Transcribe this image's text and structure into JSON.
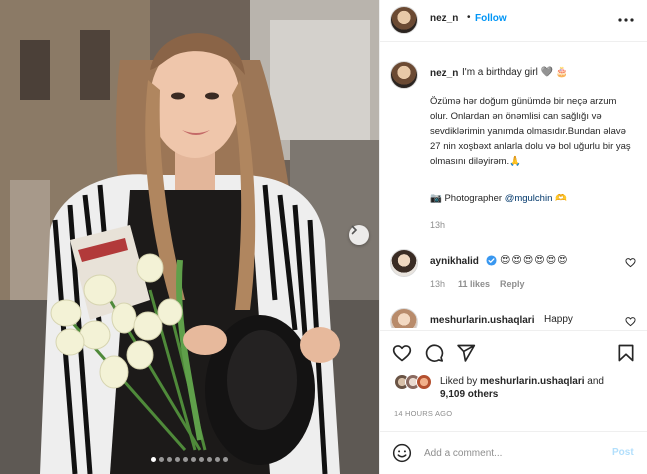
{
  "post": {
    "author": "nez_n",
    "separator": "•",
    "follow_label": "Follow",
    "more_icon": "more-options-icon",
    "image_count": 10,
    "active_image_index": 0
  },
  "caption": {
    "username": "nez_n",
    "first_line": "I'm a birthday girl 🩶 🎂",
    "body": "Özümə hər doğum günümdə bir neçə arzum olur. Onlardan ən önəmlisi can sağlığı və sevdiklərimin yanımda olmasıdır.Bundan əlavə 27 nin xoşbəxt anlarla dolu və bol uğurlu bir yaş olmasını diləyirəm.🙏",
    "photo_prefix": "📷 Photographer",
    "photo_mention": "@mgulchin",
    "photo_suffix": "🫶",
    "time": "13h"
  },
  "comments": [
    {
      "username": "aynikhalid",
      "verified": true,
      "text": "😍😍😍😍😍😍",
      "time": "13h",
      "likes": "11 likes",
      "reply": "Reply"
    },
    {
      "username": "meshurlarin.ushaqlari",
      "text": "Happy"
    }
  ],
  "likes": {
    "prefix": "Liked by",
    "user": "meshurlarin.ushaqlari",
    "connector": "and",
    "others": "9,109 others"
  },
  "timestamp": "14 HOURS AGO",
  "add_comment": {
    "placeholder": "Add a comment...",
    "post_label": "Post"
  },
  "colors": {
    "accent": "#0095f6",
    "post_disabled": "#b2dffc",
    "muted": "#8e8e8e",
    "text": "#262626"
  }
}
